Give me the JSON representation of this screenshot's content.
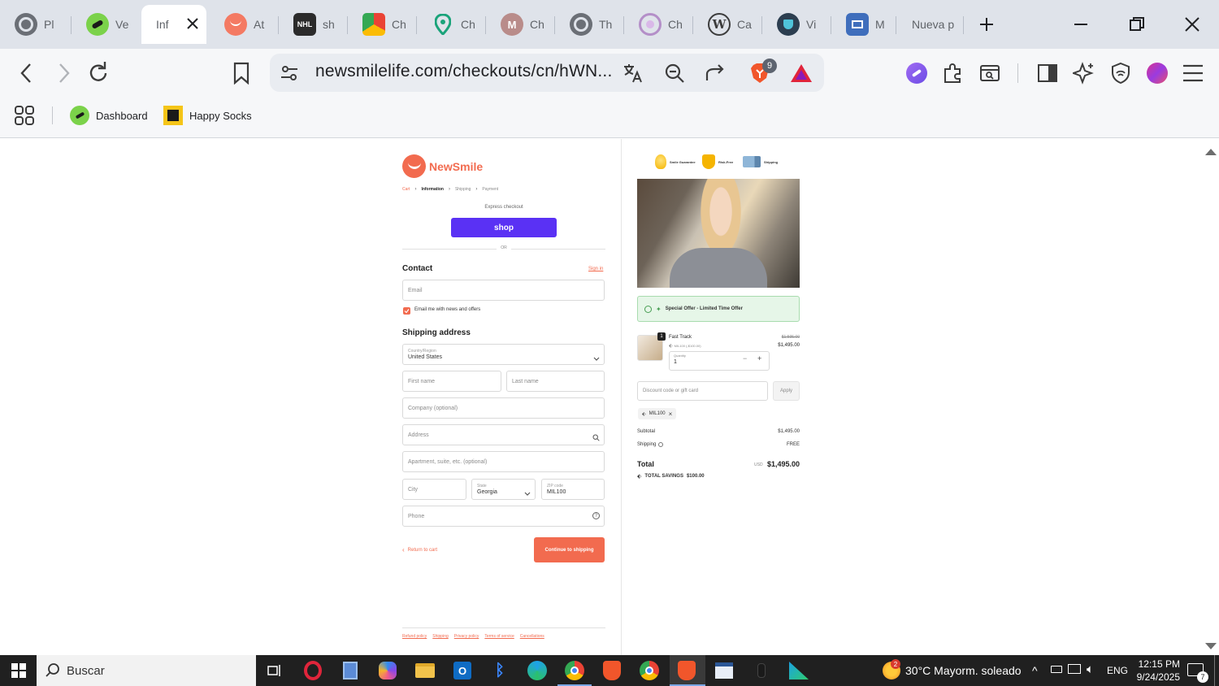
{
  "browser": {
    "tabs": [
      {
        "label": "Pl",
        "icon": "globe-icon"
      },
      {
        "label": "Ve",
        "icon": "newsmile-pen-icon"
      },
      {
        "label": "Inf",
        "icon": "none",
        "active": true
      },
      {
        "label": "At",
        "icon": "newsmile-logo-icon"
      },
      {
        "label": "sh",
        "icon": "nhl-icon"
      },
      {
        "label": "Ch",
        "icon": "chrome-icon"
      },
      {
        "label": "Ch",
        "icon": "maps-pin-icon"
      },
      {
        "label": "Ch",
        "icon": "gmail-icon"
      },
      {
        "label": "Th",
        "icon": "globe-icon"
      },
      {
        "label": "Ch",
        "icon": "circle-icon"
      },
      {
        "label": "Ca",
        "icon": "wordpress-icon"
      },
      {
        "label": "Vi",
        "icon": "shield-app-icon"
      },
      {
        "label": "M",
        "icon": "photo-icon"
      },
      {
        "label": "Nueva p",
        "icon": "none"
      }
    ],
    "url": "newsmilelife.com/checkouts/cn/hWN...",
    "brave_badge": "9",
    "bookmarks": [
      {
        "label": "Dashboard"
      },
      {
        "label": "Happy Socks"
      }
    ]
  },
  "checkout": {
    "brand": "NewSmile",
    "breadcrumb": [
      "Cart",
      "Information",
      "Shipping",
      "Payment"
    ],
    "express_label": "Express checkout",
    "shop_button": "shop",
    "or_label": "OR",
    "contact_title": "Contact",
    "sign_in": "Sign in",
    "email_placeholder": "Email",
    "newsletter_label": "Email me with news and offers",
    "shipping_title": "Shipping address",
    "country_label": "Country/Region",
    "country_value": "United States",
    "first_name": "First name",
    "last_name": "Last name",
    "company": "Company (optional)",
    "address": "Address",
    "apartment": "Apartment, suite, etc. (optional)",
    "city": "City",
    "state_label": "State",
    "state_value": "Georgia",
    "zip_label": "ZIP code",
    "zip_value": "MIL100",
    "phone": "Phone",
    "return_link": "Return to cart",
    "continue_button": "Continue to shipping",
    "footer_links": [
      "Refund policy",
      "Shipping",
      "Privacy policy",
      "Terms of service",
      "Cancellations"
    ]
  },
  "summary": {
    "badges": [
      "Smile Guarantee",
      "Risk-Free",
      "Shipping"
    ],
    "offer_text": "Special Offer - Limited Time Offer",
    "item_qty_badge": "1",
    "item_name": "Fast Track",
    "item_discount": "MIL100 (-$100.00)",
    "item_old_price": "$1,595.00",
    "item_price": "$1,495.00",
    "quantity_label": "Quantity",
    "quantity_value": "1",
    "discount_placeholder": "Discount code or gift card",
    "apply_button": "Apply",
    "applied_code": "MIL100",
    "subtotal_label": "Subtotal",
    "subtotal_value": "$1,495.00",
    "shipping_label": "Shipping",
    "shipping_value": "FREE",
    "total_label": "Total",
    "currency": "USD",
    "total_value": "$1,495.00",
    "savings_label": "TOTAL SAVINGS",
    "savings_value": "$100.00"
  },
  "taskbar": {
    "search_placeholder": "Buscar",
    "weather": "30°C  Mayorm. soleado",
    "weather_badge": "2",
    "language": "ENG",
    "time": "12:15 PM",
    "date": "9/24/2025",
    "notif_count": "7"
  },
  "colors": {
    "brand_orange": "#f26b4f",
    "shop_purple": "#5a31f4",
    "tab_strip": "#dfe3ea",
    "offer_bg": "#e6f6e8",
    "taskbar": "#202020"
  }
}
